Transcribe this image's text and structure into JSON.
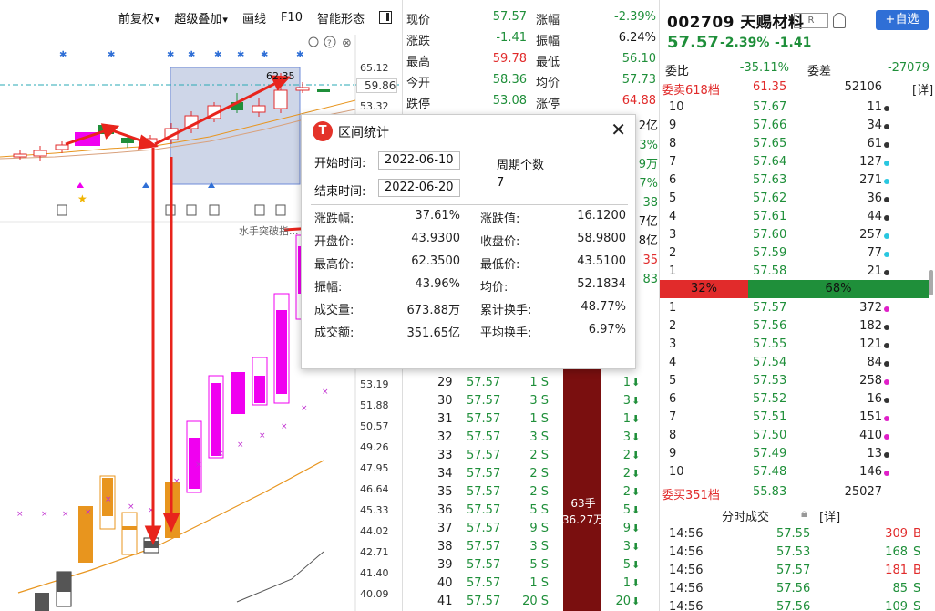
{
  "toolbar": {
    "items": [
      "前复权",
      "超级叠加",
      "画线",
      "F10",
      "智能形态"
    ]
  },
  "price_axis": [
    "65.12",
    "59.86",
    "53.32",
    "53.19",
    "51.88",
    "50.57",
    "49.26",
    "47.95",
    "46.64",
    "45.33",
    "44.02",
    "42.71",
    "41.40",
    "40.09"
  ],
  "chart_labels": {
    "peak_price": "62.35",
    "indicator": "水手突破指..."
  },
  "quote": {
    "rows": [
      {
        "l1": "现价",
        "v1": "57.57",
        "l2": "涨幅",
        "v2": "-2.39%",
        "c1": "#1f8f3a",
        "c2": "#1f8f3a"
      },
      {
        "l1": "涨跌",
        "v1": "-1.41",
        "l2": "振幅",
        "v2": "6.24%",
        "c1": "#1f8f3a",
        "c2": "#111111"
      },
      {
        "l1": "最高",
        "v1": "59.78",
        "l2": "最低",
        "v2": "56.10",
        "c1": "#e12b2b",
        "c2": "#1f8f3a"
      },
      {
        "l1": "今开",
        "v1": "58.36",
        "l2": "均价",
        "v2": "57.73",
        "c1": "#1f8f3a",
        "c2": "#1f8f3a"
      },
      {
        "l1": "跌停",
        "v1": "53.08",
        "l2": "涨停",
        "v2": "64.88",
        "c1": "#1f8f3a",
        "c2": "#e12b2b"
      }
    ],
    "partial_right": [
      "2亿",
      "3%",
      "9万",
      "7%",
      "38",
      "7亿",
      "8亿",
      "35",
      "83"
    ],
    "ticks": [
      {
        "n": "29",
        "p": "57.57",
        "q": "1 S",
        "r": "1"
      },
      {
        "n": "30",
        "p": "57.57",
        "q": "3 S",
        "r": "3"
      },
      {
        "n": "31",
        "p": "57.57",
        "q": "1 S",
        "r": "1"
      },
      {
        "n": "32",
        "p": "57.57",
        "q": "3 S",
        "r": "3"
      },
      {
        "n": "33",
        "p": "57.57",
        "q": "2 S",
        "r": "2"
      },
      {
        "n": "34",
        "p": "57.57",
        "q": "2 S",
        "r": "2"
      },
      {
        "n": "35",
        "p": "57.57",
        "q": "2 S",
        "r": "2"
      },
      {
        "n": "36",
        "p": "57.57",
        "q": "5 S",
        "r": "5"
      },
      {
        "n": "37",
        "p": "57.57",
        "q": "9 S",
        "r": "9"
      },
      {
        "n": "38",
        "p": "57.57",
        "q": "3 S",
        "r": "3"
      },
      {
        "n": "39",
        "p": "57.57",
        "q": "5 S",
        "r": "5"
      },
      {
        "n": "40",
        "p": "57.57",
        "q": "1 S",
        "r": "1"
      },
      {
        "n": "41",
        "p": "57.57",
        "q": "20 S",
        "r": "20"
      }
    ],
    "big_order_line1": "63手",
    "big_order_line2": "36.27万"
  },
  "stock": {
    "code_name": "002709 天赐材料",
    "badge": "R",
    "add_watch": "+自选",
    "price": "57.57",
    "change_pct": "-2.39%",
    "change": "-1.41",
    "weibi_label": "委比",
    "weibi_value": "-35.11%",
    "weicha_label": "委差",
    "weicha_value": "-27079",
    "sell_head_label": "委卖618档",
    "sell_head_price": "61.35",
    "sell_head_vol": "52106",
    "detail_label": "[详]",
    "sells": [
      {
        "n": "10",
        "p": "57.67",
        "v": "11",
        "dot": "#333333"
      },
      {
        "n": "9",
        "p": "57.66",
        "v": "34",
        "dot": "#333333"
      },
      {
        "n": "8",
        "p": "57.65",
        "v": "61",
        "dot": "#333333"
      },
      {
        "n": "7",
        "p": "57.64",
        "v": "127",
        "dot": "#29c7e0"
      },
      {
        "n": "6",
        "p": "57.63",
        "v": "271",
        "dot": "#29c7e0"
      },
      {
        "n": "5",
        "p": "57.62",
        "v": "36",
        "dot": "#333333"
      },
      {
        "n": "4",
        "p": "57.61",
        "v": "44",
        "dot": "#333333"
      },
      {
        "n": "3",
        "p": "57.60",
        "v": "257",
        "dot": "#29c7e0"
      },
      {
        "n": "2",
        "p": "57.59",
        "v": "77",
        "dot": "#29c7e0"
      },
      {
        "n": "1",
        "p": "57.58",
        "v": "21",
        "dot": "#333333"
      }
    ],
    "buy_ratio": "32%",
    "sell_ratio": "68%",
    "buys": [
      {
        "n": "1",
        "p": "57.57",
        "v": "372",
        "dot": "#e020c8"
      },
      {
        "n": "2",
        "p": "57.56",
        "v": "182",
        "dot": "#333333"
      },
      {
        "n": "3",
        "p": "57.55",
        "v": "121",
        "dot": "#333333"
      },
      {
        "n": "4",
        "p": "57.54",
        "v": "84",
        "dot": "#333333"
      },
      {
        "n": "5",
        "p": "57.53",
        "v": "258",
        "dot": "#e020c8"
      },
      {
        "n": "6",
        "p": "57.52",
        "v": "16",
        "dot": "#333333"
      },
      {
        "n": "7",
        "p": "57.51",
        "v": "151",
        "dot": "#e020c8"
      },
      {
        "n": "8",
        "p": "57.50",
        "v": "410",
        "dot": "#e020c8"
      },
      {
        "n": "9",
        "p": "57.49",
        "v": "13",
        "dot": "#333333"
      },
      {
        "n": "10",
        "p": "57.48",
        "v": "146",
        "dot": "#e020c8"
      }
    ],
    "buy_head_label": "委买351档",
    "buy_head_price": "55.83",
    "buy_head_vol": "25027",
    "trades_title": "分时成交",
    "trades": [
      {
        "t": "14:56",
        "p": "57.55",
        "v": "309",
        "d": "B",
        "c": "#e12b2b"
      },
      {
        "t": "14:56",
        "p": "57.53",
        "v": "168",
        "d": "S",
        "c": "#1f8f3a"
      },
      {
        "t": "14:56",
        "p": "57.57",
        "v": "181",
        "d": "B",
        "c": "#e12b2b"
      },
      {
        "t": "14:56",
        "p": "57.56",
        "v": "85",
        "d": "S",
        "c": "#1f8f3a"
      },
      {
        "t": "14:56",
        "p": "57.56",
        "v": "109",
        "d": "S",
        "c": "#1f8f3a"
      }
    ]
  },
  "dialog": {
    "title": "区间统计",
    "start_label": "开始时间:",
    "start_value": "2022-06-10",
    "end_label": "结束时间:",
    "end_value": "2022-06-20",
    "period_label": "周期个数",
    "period_value": "7",
    "rows": [
      {
        "l1": "涨跌幅:",
        "v1": "37.61%",
        "l2": "涨跌值:",
        "v2": "16.1200"
      },
      {
        "l1": "开盘价:",
        "v1": "43.9300",
        "l2": "收盘价:",
        "v2": "58.9800"
      },
      {
        "l1": "最高价:",
        "v1": "62.3500",
        "l2": "最低价:",
        "v2": "43.5100"
      },
      {
        "l1": "振幅:",
        "v1": "43.96%",
        "l2": "均价:",
        "v2": "52.1834"
      },
      {
        "l1": "成交量:",
        "v1": "673.88万",
        "l2": "累计换手:",
        "v2": "48.77%"
      },
      {
        "l1": "成交额:",
        "v1": "351.65亿",
        "l2": "平均换手:",
        "v2": "6.97%"
      }
    ]
  },
  "colors": {
    "up": "#e12b2b",
    "down": "#1f8f3a",
    "magenta": "#f000f0",
    "orange": "#e8951e",
    "select": "#c9d2e6",
    "brand_blue": "#2f6fd6"
  }
}
